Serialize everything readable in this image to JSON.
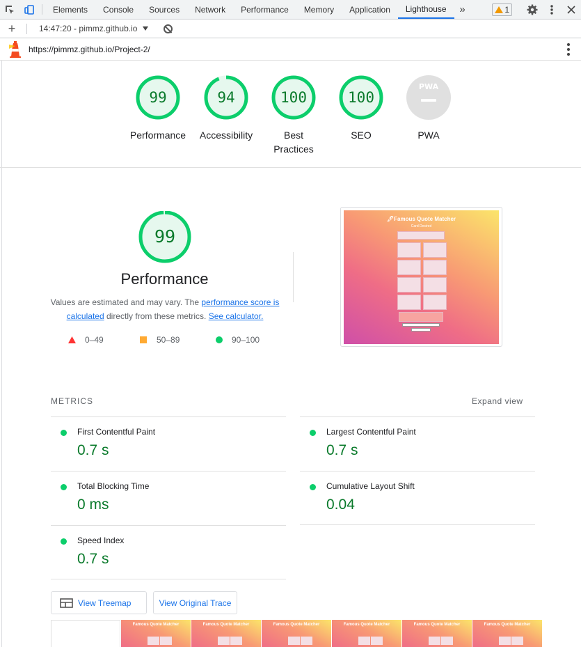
{
  "devtools": {
    "tabs": [
      "Elements",
      "Console",
      "Sources",
      "Network",
      "Performance",
      "Memory",
      "Application",
      "Lighthouse"
    ],
    "active_tab": "Lighthouse",
    "overflow_label": "»",
    "warnings_count": "1"
  },
  "toolbar": {
    "add_label": "+",
    "report_label": "14:47:20 - pimmz.github.io"
  },
  "url": "https://pimmz.github.io/Project-2/",
  "gauges": [
    {
      "score": "99",
      "label": "Performance"
    },
    {
      "score": "94",
      "label": "Accessibility"
    },
    {
      "score": "100",
      "label": "Best Practices"
    },
    {
      "score": "100",
      "label": "SEO"
    },
    {
      "score": "",
      "label": "PWA",
      "badge": "PWA"
    }
  ],
  "performance": {
    "score": "99",
    "title": "Performance",
    "desc_prefix": "Values are estimated and may vary. The ",
    "link_score": "performance score is calculated",
    "desc_middle": " directly from these metrics. ",
    "link_calc": "See calculator.",
    "legend": [
      {
        "label": "0–49",
        "color": "#ff3333",
        "shape": "triangle"
      },
      {
        "label": "50–89",
        "color": "#ffaa33",
        "shape": "square"
      },
      {
        "label": "90–100",
        "color": "#0cce6b",
        "shape": "circle"
      }
    ]
  },
  "screenshot": {
    "title": "🖊Famous Quote Matcher",
    "subtitle": "Card Desired"
  },
  "metrics": {
    "heading": "METRICS",
    "expand_label": "Expand view",
    "items": [
      {
        "name": "First Contentful Paint",
        "value": "0.7 s"
      },
      {
        "name": "Largest Contentful Paint",
        "value": "0.7 s"
      },
      {
        "name": "Total Blocking Time",
        "value": "0 ms"
      },
      {
        "name": "Cumulative Layout Shift",
        "value": "0.04"
      },
      {
        "name": "Speed Index",
        "value": "0.7 s"
      }
    ]
  },
  "buttons": {
    "treemap": "View Treemap",
    "trace": "View Original Trace"
  },
  "filmstrip": {
    "frame_title": "Famous Quote Matcher"
  },
  "colors": {
    "pass": "#0cce6b",
    "pass_text": "#0a7a2b",
    "accent": "#1a73e8",
    "pwa_gray": "#e0e0e0"
  }
}
